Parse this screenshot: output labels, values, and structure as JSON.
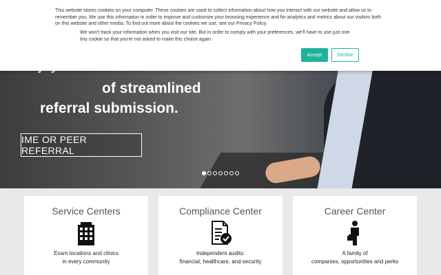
{
  "cookie_banner": {
    "text1": "This website stores cookies on your computer. These cookies are used to collect information about how you interact with our website and allow us to remember you. We use this information in order to improve and customize your browsing experience and for analytics and metrics about our visitors both on this website and other media. To find out more about the cookies we use, see our Privacy Policy.",
    "text2": "We won't track your information when you visit our site. But in order to comply with your preferences, we'll have to use just one tiny cookie so that you're not asked to make this choice again.",
    "accept_label": "Accept",
    "decline_label": "Decline",
    "accent_color": "#1db39b"
  },
  "hero": {
    "line1": "Enjoy the benefits",
    "line2": "of streamlined",
    "line3": "referral submission.",
    "cta_label": "IME OR PEER REFERRAL",
    "slides_total": 7,
    "active_slide": 1
  },
  "cards": [
    {
      "title": "Service Centers",
      "icon": "office-building-icon",
      "desc1": "Exam locations and clinics",
      "desc2": "in every community"
    },
    {
      "title": "Compliance Center",
      "icon": "document-check-icon",
      "desc1": "Independent audits:",
      "desc2": "financial, healthcare, and security"
    },
    {
      "title": "Career Center",
      "icon": "businessperson-icon",
      "desc1": "A family of",
      "desc2": "companies, opportunities and perks"
    }
  ]
}
